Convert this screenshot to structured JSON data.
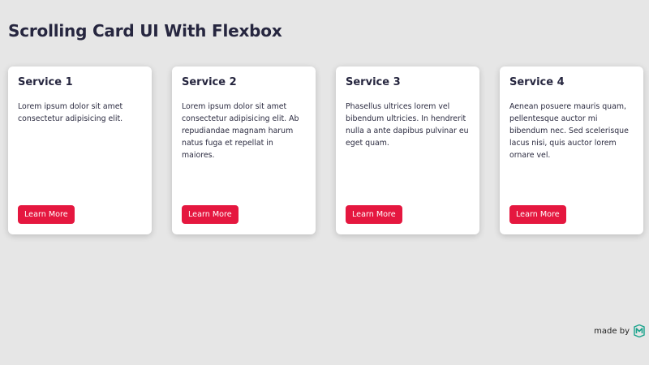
{
  "page": {
    "title": "Scrolling Card UI With Flexbox"
  },
  "cards": [
    {
      "title": "Service 1",
      "text": "Lorem ipsum dolor sit amet consectetur adipisicing elit.",
      "button_label": "Learn More"
    },
    {
      "title": "Service 2",
      "text": "Lorem ipsum dolor sit amet consectetur adipisicing elit. Ab repudiandae magnam harum natus fuga et repellat in maiores.",
      "button_label": "Learn More"
    },
    {
      "title": "Service 3",
      "text": "Phasellus ultrices lorem vel bibendum ultricies. In hendrerit nulla a ante dapibus pulvinar eu eget quam.",
      "button_label": "Learn More"
    },
    {
      "title": "Service 4",
      "text": "Aenean posuere mauris quam, pellentesque auctor mi bibendum nec. Sed scelerisque lacus nisi, quis auctor lorem ornare vel.",
      "button_label": "Learn More"
    }
  ],
  "footer": {
    "made_by": "made by",
    "logo_icon": "m-logo-icon"
  },
  "colors": {
    "background": "#e6e6e6",
    "accent": "#e5173f",
    "logo": "#1aa38c"
  }
}
